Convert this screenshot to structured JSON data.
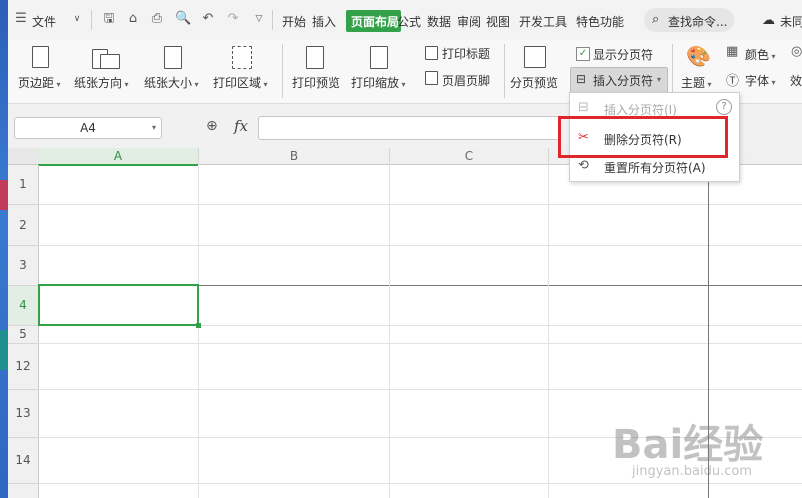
{
  "menu": {
    "file_label": "文件",
    "tabs": [
      "开始",
      "插入",
      "页面布局",
      "公式",
      "数据",
      "审阅",
      "视图",
      "开发工具",
      "特色功能"
    ],
    "active_tab": "页面布局",
    "search_placeholder": "查找命令...",
    "cloud_label": "未同"
  },
  "ribbon": {
    "margins": "页边距",
    "orientation": "纸张方向",
    "size": "纸张大小",
    "print_area": "打印区域",
    "print_preview": "打印预览",
    "print_scaling": "打印缩放",
    "print_titles": "打印标题",
    "header_footer": "页眉页脚",
    "page_break_preview": "分页预览",
    "show_page_breaks": "显示分页符",
    "insert_page_break": "插入分页符",
    "theme": "主题",
    "colors": "颜色",
    "fonts": "字体",
    "effects": "效"
  },
  "formula_bar": {
    "name_box": "A4",
    "fx": "fx"
  },
  "grid": {
    "columns": [
      "A",
      "B",
      "C"
    ],
    "rows": [
      "1",
      "2",
      "3",
      "4",
      "5",
      "12",
      "13",
      "14"
    ],
    "selected_cell": "A4"
  },
  "dropdown": {
    "items": [
      {
        "label": "插入分页符(I)",
        "enabled": false
      },
      {
        "label": "删除分页符(R)",
        "enabled": true
      },
      {
        "label": "重置所有分页符(A)",
        "enabled": true
      }
    ]
  },
  "watermark": {
    "brand": "Bai经验",
    "url": "jingyan.baidu.com"
  },
  "colors": {
    "accent_green": "#33a04a",
    "highlight_red": "#e0262b"
  }
}
